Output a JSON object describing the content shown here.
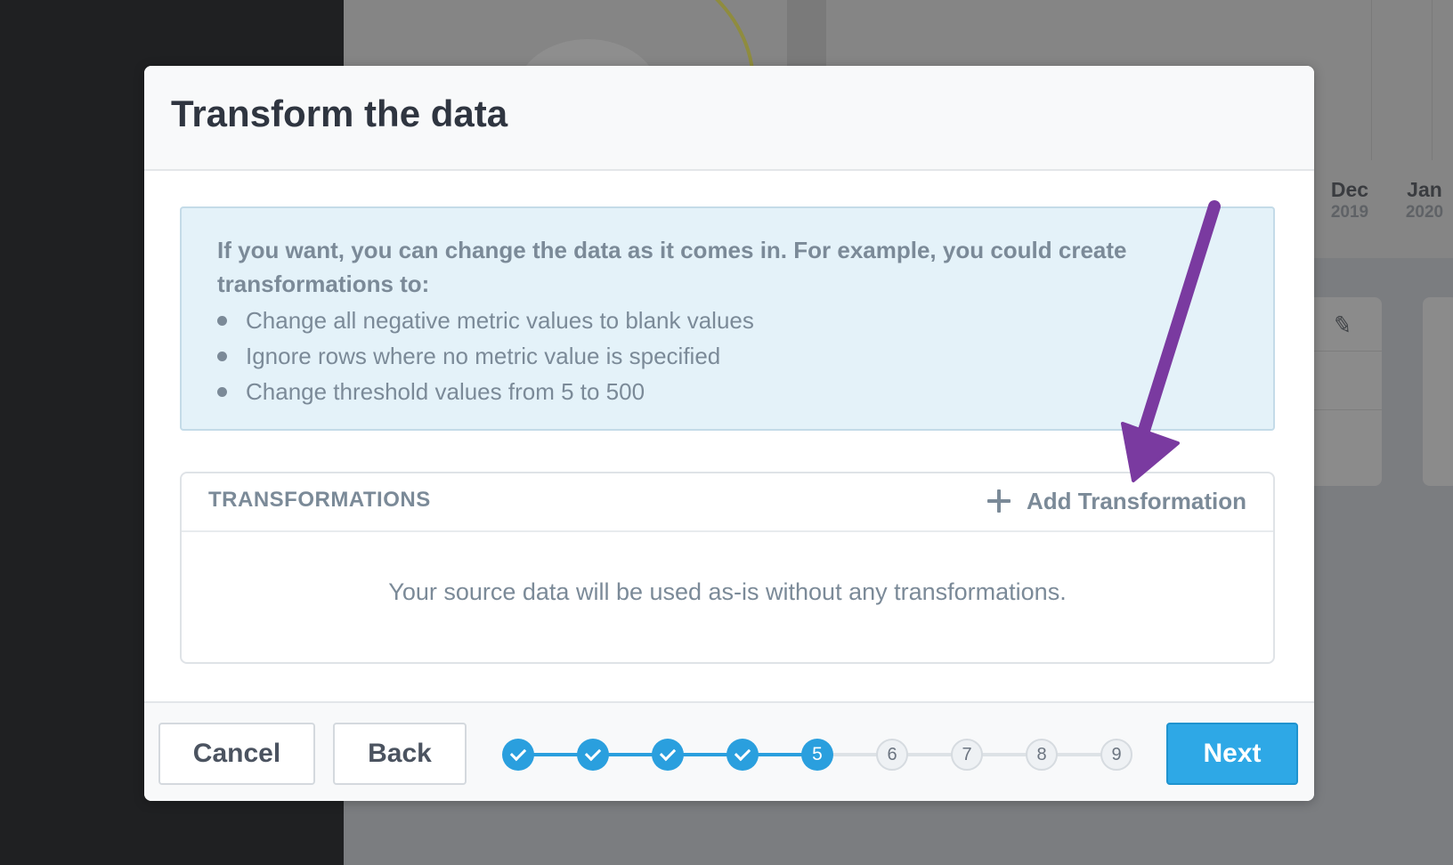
{
  "background": {
    "months": [
      {
        "month": "Dec",
        "year": "2019"
      },
      {
        "month": "Jan",
        "year": "2020"
      }
    ]
  },
  "modal": {
    "title": "Transform the data",
    "info": {
      "intro": "If you want, you can change the data as it comes in. For example, you could create transformations to:",
      "bullets": [
        "Change all negative metric values to blank values",
        "Ignore rows where no metric value is specified",
        "Change threshold values from 5 to 500"
      ]
    },
    "transformations": {
      "header": "TRANSFORMATIONS",
      "add_label": "Add Transformation",
      "empty_message": "Your source data will be used as-is without any transformations."
    },
    "footer": {
      "cancel_label": "Cancel",
      "back_label": "Back",
      "next_label": "Next",
      "steps": [
        {
          "label": "1",
          "status": "complete"
        },
        {
          "label": "2",
          "status": "complete"
        },
        {
          "label": "3",
          "status": "complete"
        },
        {
          "label": "4",
          "status": "complete"
        },
        {
          "label": "5",
          "status": "current"
        },
        {
          "label": "6",
          "status": "pending"
        },
        {
          "label": "7",
          "status": "pending"
        },
        {
          "label": "8",
          "status": "pending"
        },
        {
          "label": "9",
          "status": "pending"
        }
      ],
      "current_step": 5,
      "total_steps": 9
    }
  },
  "colors": {
    "accent": "#2ea8e6",
    "annotation_arrow": "#7a3aa0",
    "info_background": "#e4f2f9",
    "text_muted": "#7b8a98"
  },
  "icons": {
    "add": "plus-icon",
    "step_done": "check-icon",
    "annotation": "arrow-annotation-icon",
    "edit": "pencil-icon"
  }
}
